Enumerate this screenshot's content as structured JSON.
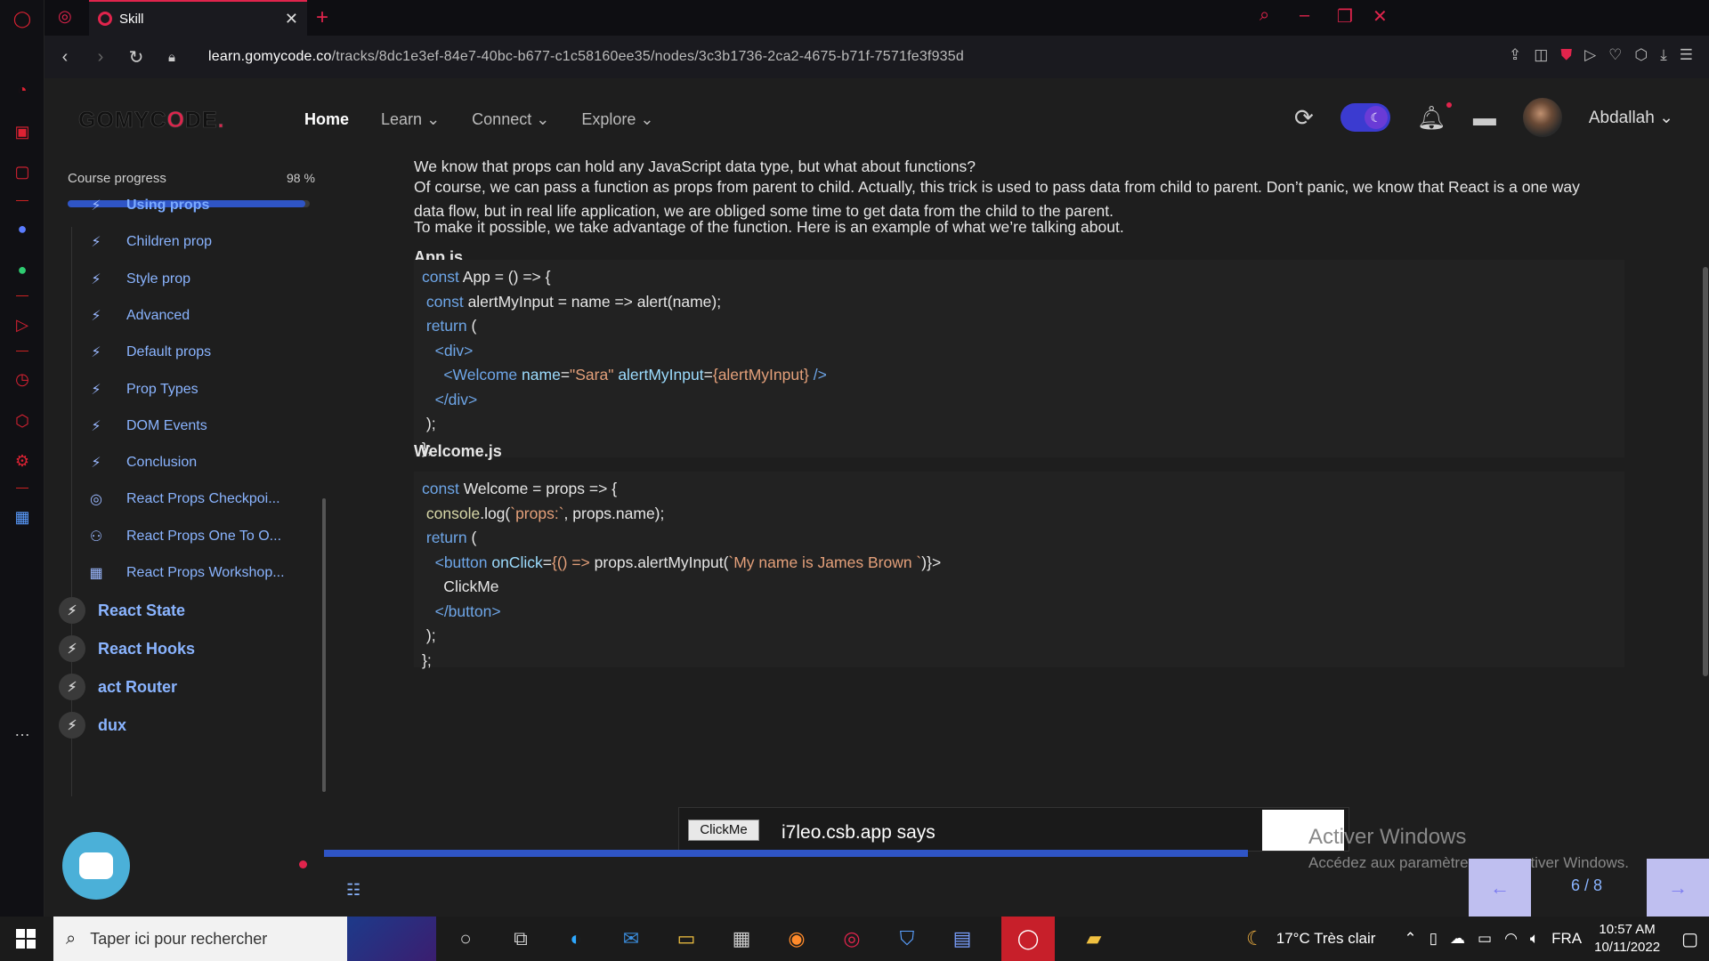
{
  "browser": {
    "tab_title": "Skill",
    "url_host": "learn.gomycode.co",
    "url_path": "/tracks/8dc1e3ef-84e7-40bc-b677-c1c58160ee35/nodes/3c3b1736-2ca2-4675-b71f-7571fe3f935d"
  },
  "site": {
    "logo_prefix": "GOMYC",
    "logo_o": "O",
    "logo_suffix": "DE",
    "logo_dot": ".",
    "nav": {
      "home": "Home",
      "learn": "Learn",
      "connect": "Connect",
      "explore": "Explore"
    },
    "username": "Abdallah"
  },
  "sidebar": {
    "progress_label": "Course progress",
    "progress_text": "98 %",
    "progress_value": 0.98,
    "lessons": [
      {
        "label": "Using props",
        "icon": "bolt-icon"
      },
      {
        "label": "Children prop",
        "icon": "bolt-icon"
      },
      {
        "label": "Style prop",
        "icon": "bolt-icon"
      },
      {
        "label": "Advanced",
        "icon": "bolt-icon"
      },
      {
        "label": "Default props",
        "icon": "bolt-icon"
      },
      {
        "label": "Prop Types",
        "icon": "bolt-icon"
      },
      {
        "label": "DOM Events",
        "icon": "bolt-icon"
      },
      {
        "label": "Conclusion",
        "icon": "bolt-icon"
      },
      {
        "label": "React Props Checkpoi...",
        "icon": "target-icon"
      },
      {
        "label": "React Props One To O...",
        "icon": "people-icon"
      },
      {
        "label": "React Props Workshop...",
        "icon": "workshop-icon"
      }
    ],
    "modules": [
      {
        "label": "React State"
      },
      {
        "label": "React Hooks"
      },
      {
        "label": "act Router"
      },
      {
        "label": "dux"
      }
    ]
  },
  "content": {
    "para1": "We know that props can hold any JavaScript data type, but what about functions?",
    "para2": "Of course, we can pass a function as props from parent to child. Actually, this trick is used to pass data from child to parent. Don’t panic, we know that React is a one way data flow, but in real life application, we are obliged some time to get data from the child to the parent.",
    "para3": "To make it possible, we take advantage of the function. Here is an example of what we’re talking about.",
    "file1": "App.js",
    "file2": "Welcome.js"
  },
  "dialog": {
    "button": "ClickMe",
    "title": "i7leo.csb.app says"
  },
  "watermark": {
    "title": "Activer Windows",
    "subtitle": "Accédez aux paramètres pour activer Windows."
  },
  "pager": {
    "count": "6 / 8"
  },
  "taskbar": {
    "search_placeholder": "Taper ici pour rechercher",
    "weather": "17°C  Très clair",
    "lang": "FRA",
    "time": "10:57 AM",
    "date": "10/11/2022"
  },
  "colors": {
    "accent": "#2f55c6",
    "brand_red": "#e0244c",
    "link": "#8ab4ff"
  }
}
